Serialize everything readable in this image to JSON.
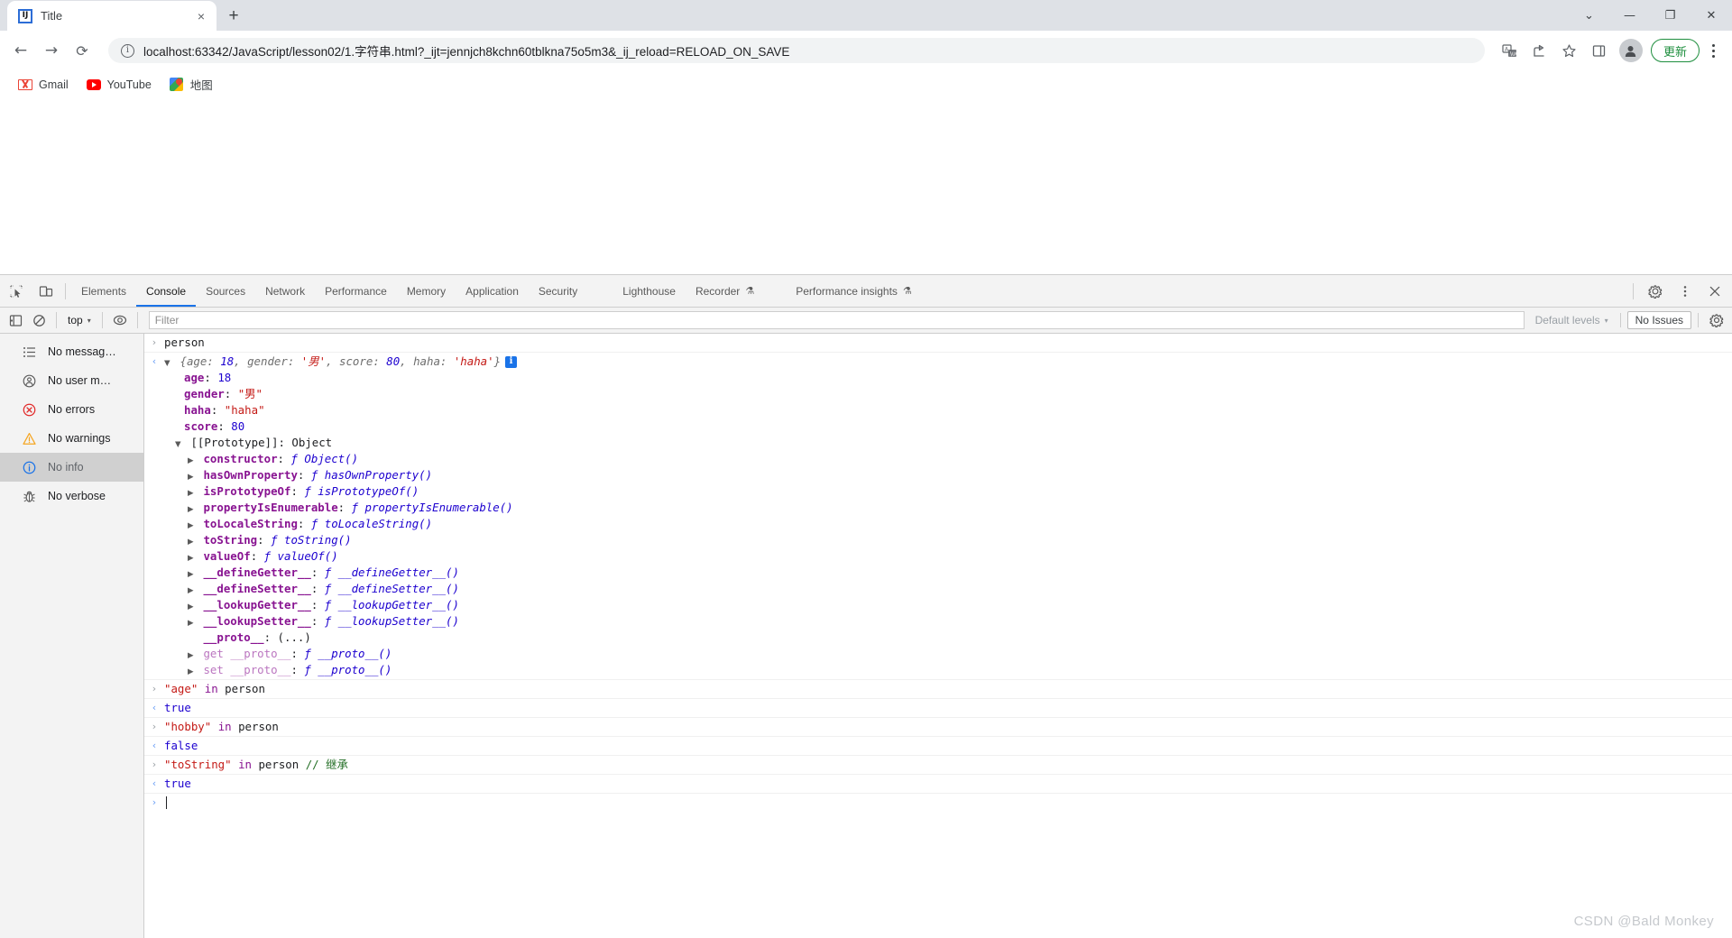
{
  "browser": {
    "tab": {
      "title": "Title",
      "favicon": "intellij-idea-icon",
      "close_label": "×"
    },
    "newtab_label": "+",
    "window_controls": {
      "collapse": "⌄",
      "minimize": "—",
      "maximize": "❐",
      "close": "✕"
    },
    "nav": {
      "back": "←",
      "forward": "→",
      "reload": "⟳"
    },
    "omnibox": {
      "info_icon": "page-info-icon",
      "url": "localhost:63342/JavaScript/lesson02/1.字符串.html?_ijt=jennjch8kchn60tblkna75o5m3&_ij_reload=RELOAD_ON_SAVE"
    },
    "toolbar_right": {
      "translate_icon": "translate-icon",
      "share_icon": "share-icon",
      "bookmark_icon": "star-icon",
      "sidepanel_icon": "side-panel-icon",
      "profile_icon": "profile-avatar",
      "update_label": "更新",
      "menu_icon": "three-dot-menu-icon"
    },
    "bookmarks": [
      {
        "label": "Gmail",
        "icon": "gmail-icon"
      },
      {
        "label": "YouTube",
        "icon": "youtube-icon"
      },
      {
        "label": "地图",
        "icon": "google-maps-icon"
      }
    ]
  },
  "devtools": {
    "inspect_icon": "inspect-element-icon",
    "device_icon": "device-toolbar-icon",
    "tabs": [
      {
        "label": "Elements",
        "active": false,
        "flask": ""
      },
      {
        "label": "Console",
        "active": true,
        "flask": ""
      },
      {
        "label": "Sources",
        "active": false,
        "flask": ""
      },
      {
        "label": "Network",
        "active": false,
        "flask": ""
      },
      {
        "label": "Performance",
        "active": false,
        "flask": ""
      },
      {
        "label": "Memory",
        "active": false,
        "flask": ""
      },
      {
        "label": "Application",
        "active": false,
        "flask": ""
      },
      {
        "label": "Security",
        "active": false,
        "flask": ""
      },
      {
        "label": "Lighthouse",
        "active": false,
        "flask": ""
      },
      {
        "label": "Recorder",
        "active": false,
        "flask": "⚗"
      },
      {
        "label": "Performance insights",
        "active": false,
        "flask": "⚗"
      }
    ],
    "panel_actions": {
      "settings_icon": "gear-icon",
      "more_icon": "three-dot-menu-icon",
      "close_icon": "close-icon"
    },
    "filterbar": {
      "sidebar_toggle_icon": "console-sidebar-toggle-icon",
      "clear_icon": "clear-console-icon",
      "context": "top",
      "caret": "▾",
      "eye_icon": "live-expression-icon",
      "filter_placeholder": "Filter",
      "filter_value": "",
      "levels_label": "Default levels",
      "issues_label": "No Issues",
      "settings_icon": "gear-icon"
    },
    "sidebar": [
      {
        "label": "No messag…",
        "icon": "list-icon",
        "selected": false
      },
      {
        "label": "No user m…",
        "icon": "user-message-icon",
        "selected": false
      },
      {
        "label": "No errors",
        "icon": "error-icon",
        "selected": false
      },
      {
        "label": "No warnings",
        "icon": "warning-icon",
        "selected": false
      },
      {
        "label": "No info",
        "icon": "info-icon",
        "selected": true
      },
      {
        "label": "No verbose",
        "icon": "bug-icon",
        "selected": false
      }
    ]
  },
  "console": {
    "input_1": "person",
    "object_preview": {
      "open_brace": "{",
      "entries": [
        {
          "key": "age",
          "sep": ": ",
          "value": "18",
          "kind": "num"
        },
        {
          "key": "gender",
          "sep": ": ",
          "value": "'男'",
          "kind": "str"
        },
        {
          "key": "score",
          "sep": ": ",
          "value": "80",
          "kind": "num"
        },
        {
          "key": "haha",
          "sep": ": ",
          "value": "'haha'",
          "kind": "str"
        }
      ],
      "close_brace": "}",
      "badge": "i"
    },
    "own_props": [
      {
        "key": "age",
        "value": "18",
        "kind": "num"
      },
      {
        "key": "gender",
        "value": "\"男\"",
        "kind": "str"
      },
      {
        "key": "haha",
        "value": "\"haha\"",
        "kind": "str"
      },
      {
        "key": "score",
        "value": "80",
        "kind": "num"
      }
    ],
    "prototype_label": "[[Prototype]]",
    "prototype_value": "Object",
    "prototype_props": [
      {
        "key": "constructor",
        "fn": "Object()",
        "dim": false,
        "arrow": true
      },
      {
        "key": "hasOwnProperty",
        "fn": "hasOwnProperty()",
        "dim": false,
        "arrow": true
      },
      {
        "key": "isPrototypeOf",
        "fn": "isPrototypeOf()",
        "dim": false,
        "arrow": true
      },
      {
        "key": "propertyIsEnumerable",
        "fn": "propertyIsEnumerable()",
        "dim": false,
        "arrow": true
      },
      {
        "key": "toLocaleString",
        "fn": "toLocaleString()",
        "dim": false,
        "arrow": true
      },
      {
        "key": "toString",
        "fn": "toString()",
        "dim": false,
        "arrow": true
      },
      {
        "key": "valueOf",
        "fn": "valueOf()",
        "dim": false,
        "arrow": true
      },
      {
        "key": "__defineGetter__",
        "fn": "__defineGetter__()",
        "dim": false,
        "arrow": true
      },
      {
        "key": "__defineSetter__",
        "fn": "__defineSetter__()",
        "dim": false,
        "arrow": true
      },
      {
        "key": "__lookupGetter__",
        "fn": "__lookupGetter__()",
        "dim": false,
        "arrow": true
      },
      {
        "key": "__lookupSetter__",
        "fn": "__lookupSetter__()",
        "dim": false,
        "arrow": true
      },
      {
        "key": "__proto__",
        "fn": "",
        "raw": "(...)",
        "dim": false,
        "arrow": false
      },
      {
        "key": "get __proto__",
        "fn": "__proto__()",
        "dim": true,
        "arrow": true
      },
      {
        "key": "set __proto__",
        "fn": "__proto__()",
        "dim": true,
        "arrow": true
      }
    ],
    "entries": [
      {
        "type": "input",
        "parts": [
          {
            "t": "\"age\"",
            "c": "s-str"
          },
          {
            "t": " ",
            "c": "s-plain"
          },
          {
            "t": "in",
            "c": "s-kw"
          },
          {
            "t": " person",
            "c": "s-plain"
          }
        ]
      },
      {
        "type": "output",
        "parts": [
          {
            "t": "true",
            "c": "s-bool"
          }
        ]
      },
      {
        "type": "input",
        "parts": [
          {
            "t": "\"hobby\"",
            "c": "s-str"
          },
          {
            "t": " ",
            "c": "s-plain"
          },
          {
            "t": "in",
            "c": "s-kw"
          },
          {
            "t": " person",
            "c": "s-plain"
          }
        ]
      },
      {
        "type": "output",
        "parts": [
          {
            "t": "false",
            "c": "s-bool"
          }
        ]
      },
      {
        "type": "input",
        "parts": [
          {
            "t": "\"toString\"",
            "c": "s-str"
          },
          {
            "t": " ",
            "c": "s-plain"
          },
          {
            "t": "in",
            "c": "s-kw"
          },
          {
            "t": " person ",
            "c": "s-plain"
          },
          {
            "t": "// 继承",
            "c": "s-cmt"
          }
        ]
      },
      {
        "type": "output",
        "parts": [
          {
            "t": "true",
            "c": "s-bool"
          }
        ]
      }
    ],
    "prompt_symbol": "›",
    "input_symbol": "›",
    "output_symbol": "‹"
  },
  "watermark": "CSDN @Bald Monkey"
}
